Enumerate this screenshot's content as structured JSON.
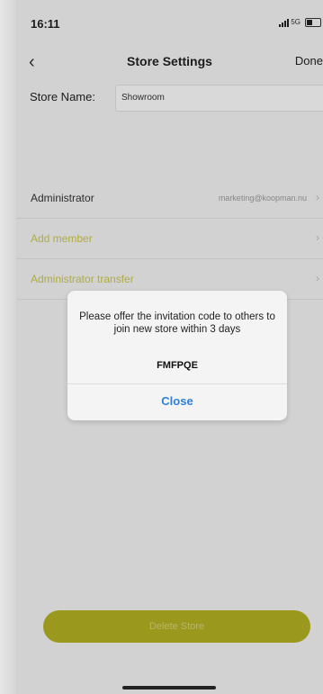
{
  "status_bar": {
    "time": "16:11",
    "network": "5G"
  },
  "header": {
    "back_icon": "chevron-left-icon",
    "title": "Store Settings",
    "done_label": "Done"
  },
  "store_name": {
    "label": "Store Name:",
    "value": "Showroom"
  },
  "list": {
    "administrator": {
      "label": "Administrator",
      "value": "marketing@koopman.nu"
    },
    "add_member": {
      "label": "Add member"
    },
    "administrator_transfer": {
      "label": "Administrator transfer"
    }
  },
  "dialog": {
    "message": "Please offer the invitation code to others to join new store within 3 days",
    "code": "FMFPQE",
    "close_label": "Close"
  },
  "delete_button": {
    "label": "Delete Store"
  },
  "colors": {
    "accent": "#b0ad22",
    "link": "#2f7fd9",
    "accent_text": "#c9c44b"
  }
}
